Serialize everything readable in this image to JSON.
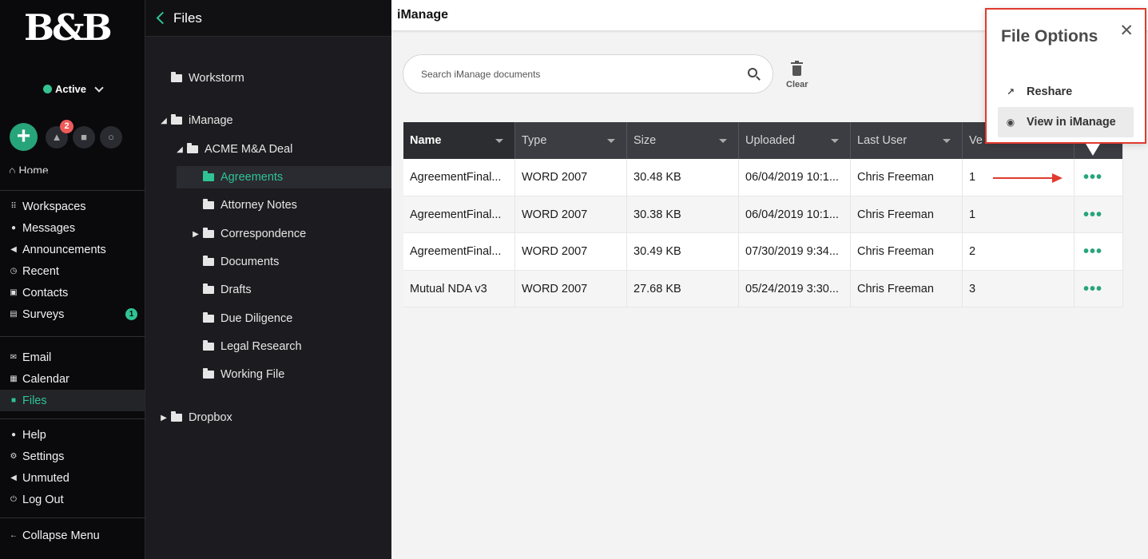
{
  "nav": {
    "logo": "B&B",
    "status": "Active",
    "alert_count": "2",
    "home_label": "Home",
    "groups": [
      [
        {
          "label": "Workspaces",
          "icon": "grid-icon",
          "glyph": "⠿"
        },
        {
          "label": "Messages",
          "icon": "chat-icon",
          "glyph": "●"
        },
        {
          "label": "Announcements",
          "icon": "megaphone-icon",
          "glyph": "◀"
        },
        {
          "label": "Recent",
          "icon": "clock-icon",
          "glyph": "◷"
        },
        {
          "label": "Contacts",
          "icon": "contact-card-icon",
          "glyph": "▣"
        },
        {
          "label": "Surveys",
          "icon": "clipboard-icon",
          "glyph": "▤",
          "badge": "1"
        }
      ],
      [
        {
          "label": "Email",
          "icon": "envelope-icon",
          "glyph": "✉"
        },
        {
          "label": "Calendar",
          "icon": "calendar-icon",
          "glyph": "▦"
        },
        {
          "label": "Files",
          "icon": "folder-icon",
          "glyph": "■",
          "active": true
        }
      ],
      [
        {
          "label": "Help",
          "icon": "info-icon",
          "glyph": "●"
        },
        {
          "label": "Settings",
          "icon": "gear-icon",
          "glyph": "⚙"
        },
        {
          "label": "Unmuted",
          "icon": "speaker-icon",
          "glyph": "◀"
        },
        {
          "label": "Log Out",
          "icon": "power-icon",
          "glyph": "⏻"
        }
      ]
    ],
    "collapse_label": "Collapse Menu"
  },
  "tree": {
    "title": "Files",
    "nodes": [
      {
        "label": "Workstorm",
        "depth": 0,
        "toggle": "",
        "selected": false
      },
      {
        "label": "iManage",
        "depth": 0,
        "toggle": "◢",
        "selected": false
      },
      {
        "label": "ACME M&A Deal",
        "depth": 1,
        "toggle": "◢",
        "selected": false
      },
      {
        "label": "Agreements",
        "depth": 2,
        "toggle": "",
        "selected": true
      },
      {
        "label": "Attorney Notes",
        "depth": 2,
        "toggle": "",
        "selected": false
      },
      {
        "label": "Correspondence",
        "depth": 2,
        "toggle": "▶",
        "selected": false
      },
      {
        "label": "Documents",
        "depth": 2,
        "toggle": "",
        "selected": false
      },
      {
        "label": "Drafts",
        "depth": 2,
        "toggle": "",
        "selected": false
      },
      {
        "label": "Due Diligence",
        "depth": 2,
        "toggle": "",
        "selected": false
      },
      {
        "label": "Legal Research",
        "depth": 2,
        "toggle": "",
        "selected": false
      },
      {
        "label": "Working File",
        "depth": 2,
        "toggle": "",
        "selected": false
      },
      {
        "label": "Dropbox",
        "depth": 0,
        "toggle": "▶",
        "selected": false
      }
    ]
  },
  "main": {
    "title": "iManage",
    "search_placeholder": "Search iManage documents",
    "clear_label": "Clear",
    "columns": [
      "Name",
      "Type",
      "Size",
      "Uploaded",
      "Last User",
      "Ve"
    ],
    "rows": [
      [
        "AgreementFinal...",
        "WORD 2007",
        "30.48 KB",
        "06/04/2019 10:1...",
        "Chris Freeman",
        "1"
      ],
      [
        "AgreementFinal...",
        "WORD 2007",
        "30.38 KB",
        "06/04/2019 10:1...",
        "Chris Freeman",
        "1"
      ],
      [
        "AgreementFinal...",
        "WORD 2007",
        "30.49 KB",
        "07/30/2019 9:34...",
        "Chris Freeman",
        "2"
      ],
      [
        "Mutual NDA v3",
        "WORD 2007",
        "27.68 KB",
        "05/24/2019 3:30...",
        "Chris Freeman",
        "3"
      ]
    ],
    "more_glyph": "•••"
  },
  "popup": {
    "title": "File Options",
    "close_glyph": "✕",
    "options": [
      {
        "label": "Reshare",
        "icon": "share-icon",
        "glyph": "↗"
      },
      {
        "label": "View in iManage",
        "icon": "eye-icon",
        "glyph": "◉"
      }
    ],
    "highlight_color": "#e03b2f"
  },
  "colors": {
    "accent": "#2fc494",
    "nav_bg": "#0a0a0c",
    "tree_bg": "#1c1c20",
    "header_bg": "#3c3d42",
    "alert_badge": "#ef5a5a",
    "annotation_arrow": "#e03b2f"
  }
}
